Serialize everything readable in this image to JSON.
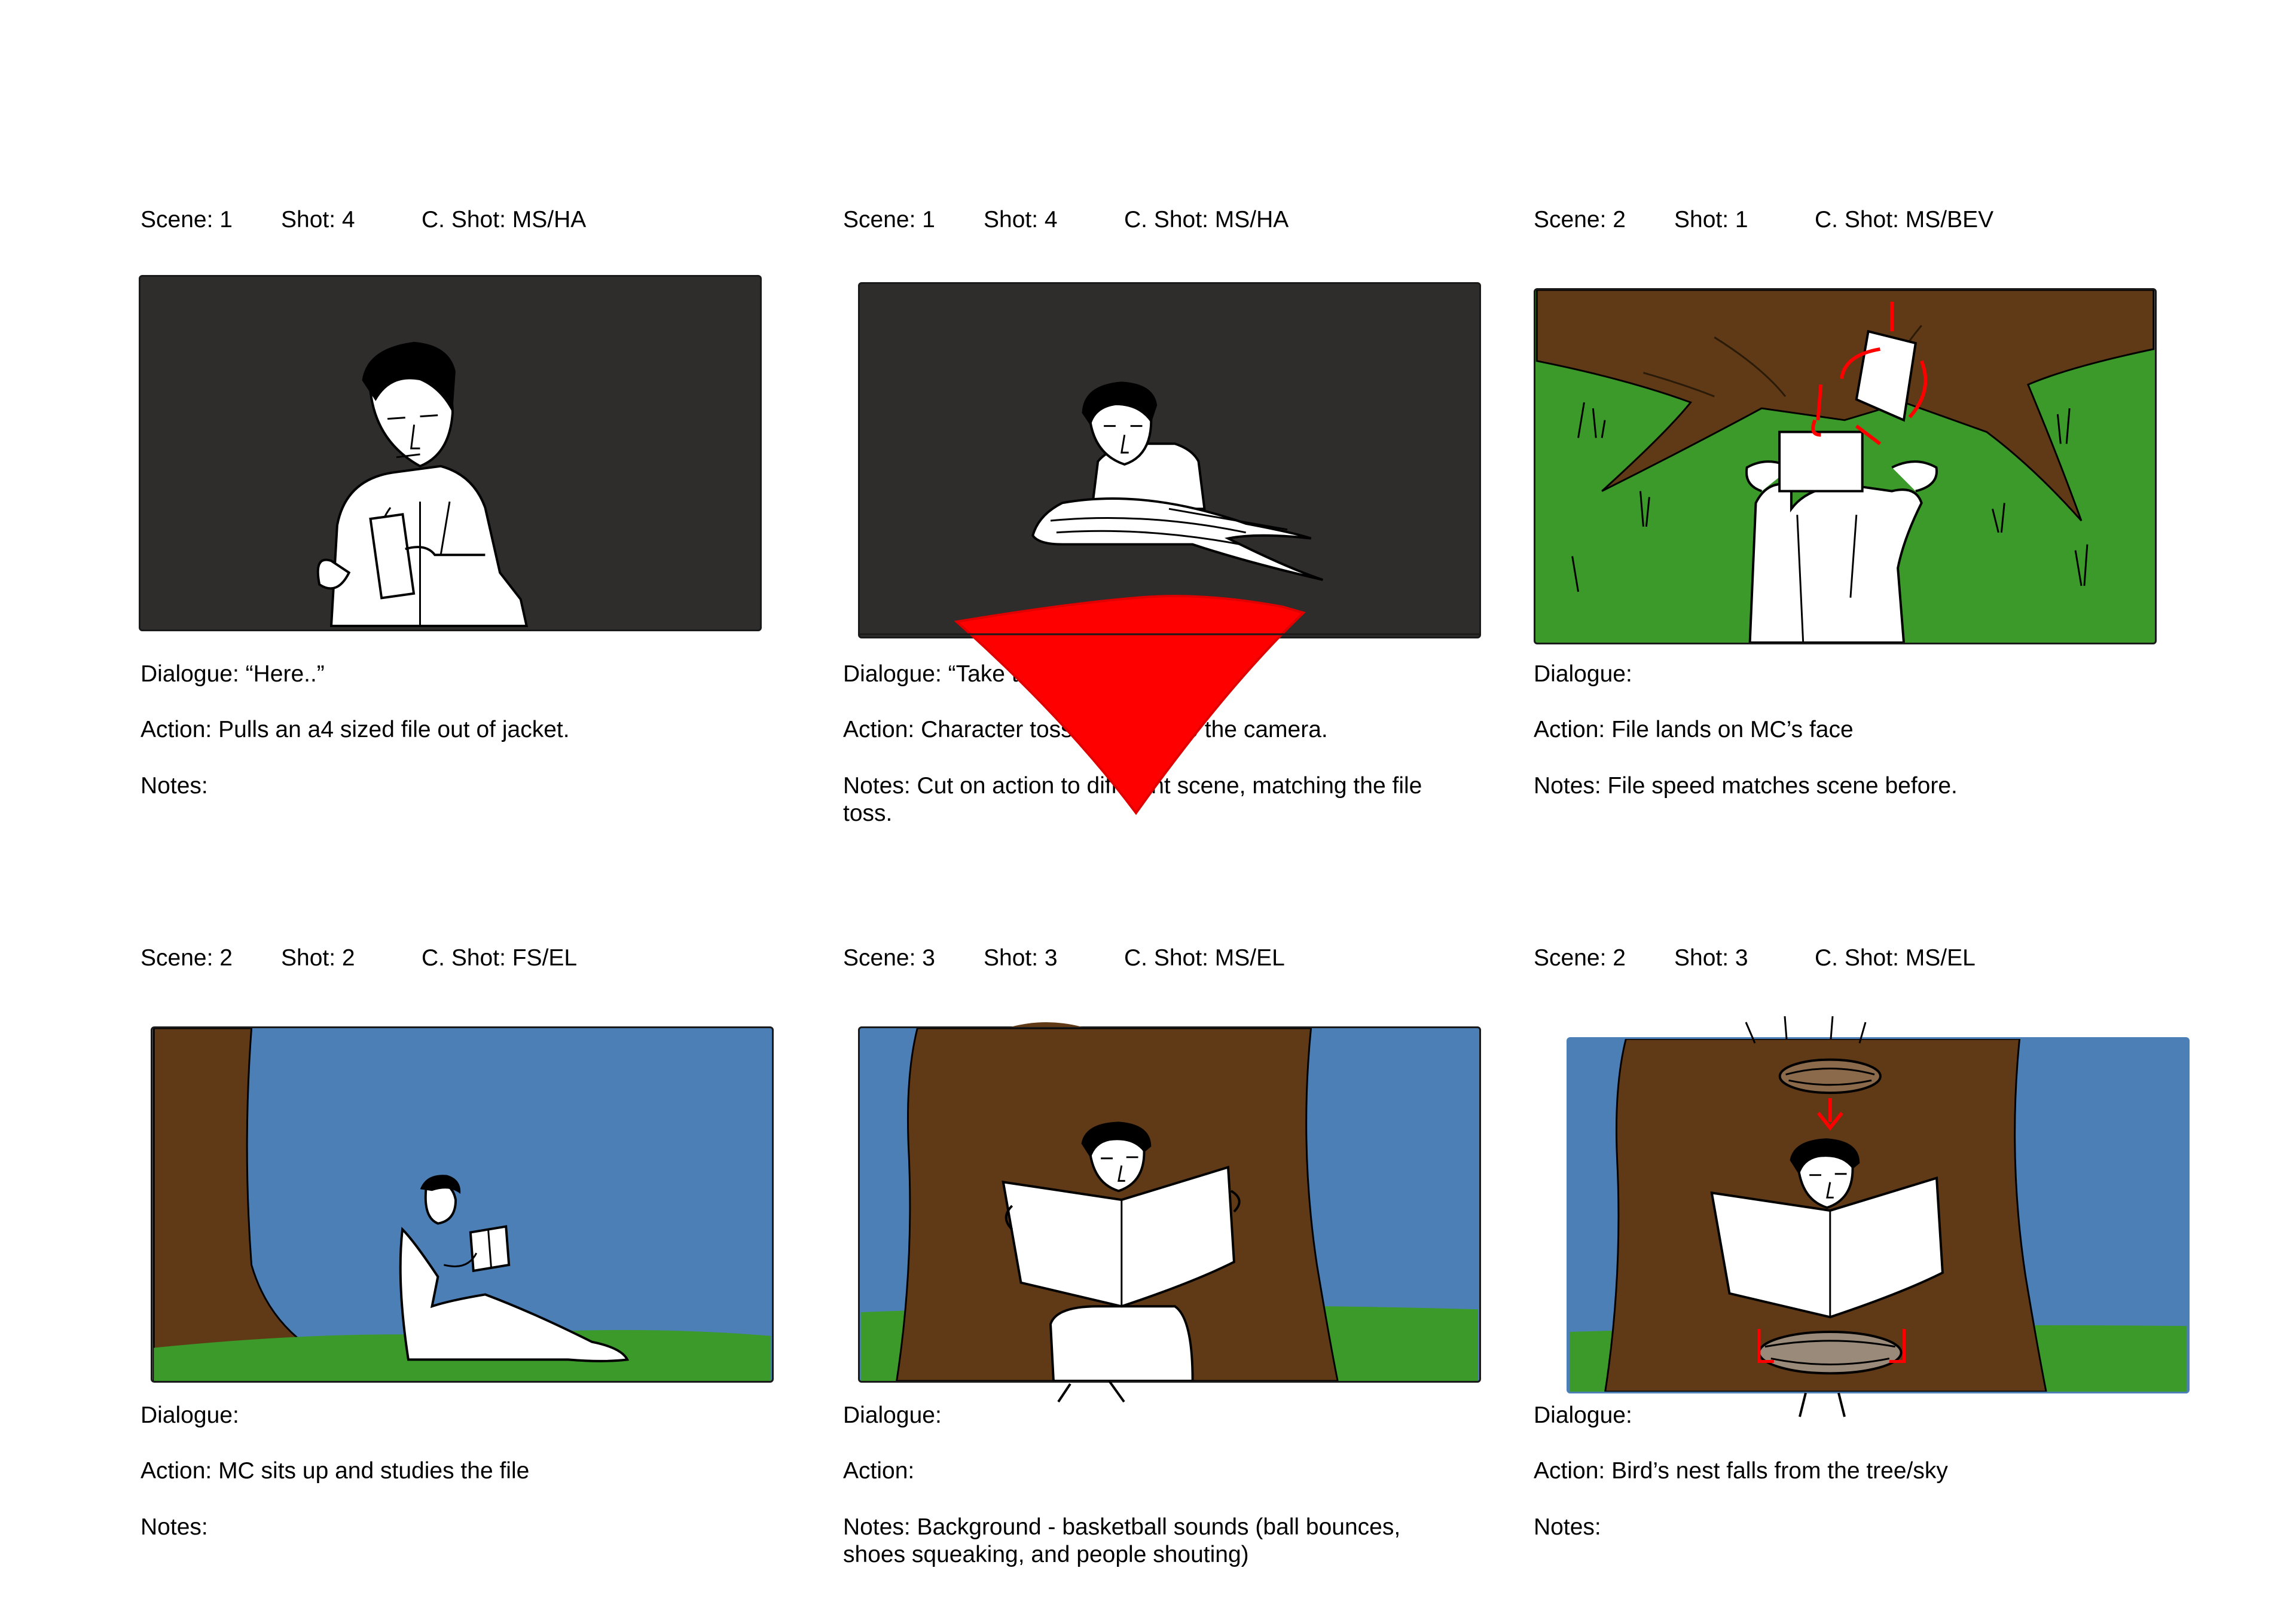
{
  "panels": [
    {
      "scene": "Scene: 1",
      "shot": "Shot: 4",
      "cshot": "C. Shot: MS/HA",
      "dialogue": "Dialogue: “Here..”",
      "action": "Action: Pulls an a4 sized file out of jacket.",
      "notes": "Notes:"
    },
    {
      "scene": "Scene: 1",
      "shot": "Shot: 4",
      "cshot": "C. Shot: MS/HA",
      "dialogue": "Dialogue: “Take this”",
      "action": "Action: Character tosses the file to the camera.",
      "notes": "Notes: Cut on action to different scene, matching the file toss."
    },
    {
      "scene": "Scene: 2",
      "shot": "Shot: 1",
      "cshot": "C. Shot: MS/BEV",
      "dialogue": "Dialogue:",
      "action": "Action: File lands on MC’s face",
      "notes": "Notes: File speed matches scene before."
    },
    {
      "scene": "Scene: 2",
      "shot": "Shot: 2",
      "cshot": "C. Shot: FS/EL",
      "dialogue": "Dialogue:",
      "action": "Action: MC sits up and studies the file",
      "notes": "Notes:"
    },
    {
      "scene": "Scene: 3",
      "shot": "Shot: 3",
      "cshot": "C. Shot: MS/EL",
      "dialogue": "Dialogue:",
      "action": "Action:",
      "notes": "Notes: Background - basketball sounds (ball bounces, shoes squeaking, and people shouting)"
    },
    {
      "scene": "Scene: 2",
      "shot": "Shot: 3",
      "cshot": "C. Shot: MS/EL",
      "dialogue": "Dialogue:",
      "action": "Action: Bird’s nest falls from the tree/sky",
      "notes": "Notes:"
    }
  ],
  "colors": {
    "night": "#2f2c2c",
    "grass": "#3b9a2a",
    "sky": "#4d7fb7",
    "bark": "#603a16",
    "arrow": "#ff0000"
  }
}
